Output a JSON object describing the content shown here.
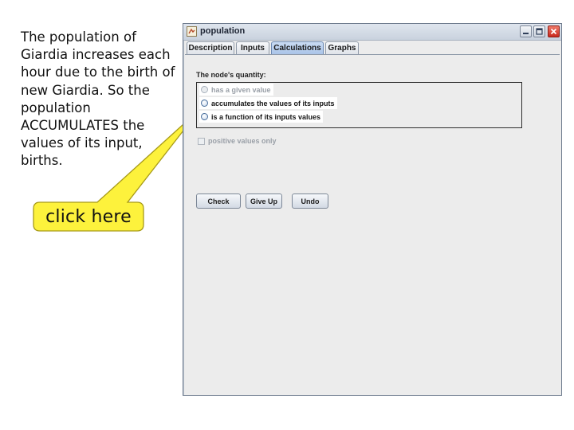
{
  "annotation": {
    "lines": [
      "The population of",
      "Giardia increases each",
      "hour due to the birth of",
      "new Giardia.  So the",
      "population",
      "ACCUMULATES the",
      "values of its input,",
      "births."
    ],
    "callout_label": "click here",
    "callout_fill": "#fdf23c",
    "callout_stroke": "#a79a18"
  },
  "window": {
    "title": "population",
    "icon": "app-icon",
    "controls": [
      "minimize-icon",
      "maximize-icon",
      "close-icon"
    ]
  },
  "tabs": [
    {
      "label": "Description",
      "active": false
    },
    {
      "label": "Inputs",
      "active": false
    },
    {
      "label": "Calculations",
      "active": true
    },
    {
      "label": "Graphs",
      "active": false
    }
  ],
  "calculations": {
    "section_label": "The node's quantity:",
    "options": [
      {
        "label": "has a given value",
        "enabled": false,
        "selected": false
      },
      {
        "label": "accumulates the values of its inputs",
        "enabled": true,
        "selected": false
      },
      {
        "label": "is a function of its inputs values",
        "enabled": true,
        "selected": false
      }
    ],
    "checkbox": {
      "label": "positive values only",
      "enabled": false,
      "checked": false
    },
    "buttons": {
      "check": "Check",
      "give_up": "Give Up",
      "undo": "Undo"
    }
  },
  "colors": {
    "active_tab": "#aac4e8",
    "window_bg": "#ececec",
    "close_button": "#c8291e"
  }
}
